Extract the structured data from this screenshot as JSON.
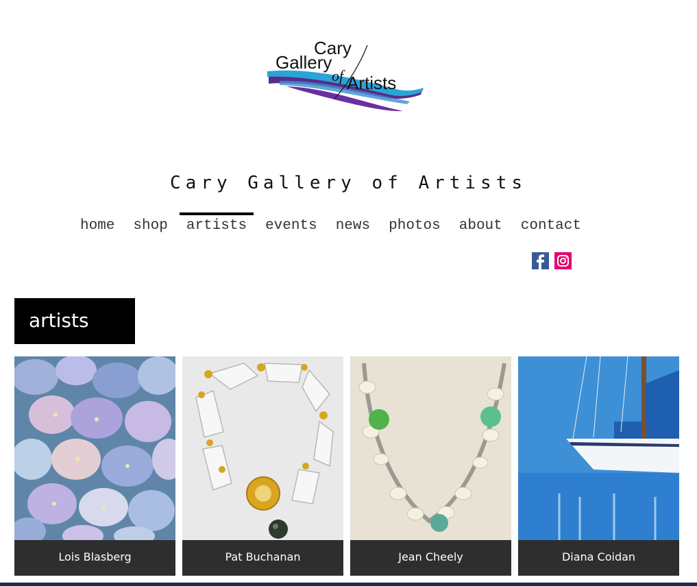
{
  "logo": {
    "line1": "Cary",
    "line2": "Gallery",
    "line3": "of",
    "line4": "Artists"
  },
  "site_title": "Cary Gallery of Artists",
  "nav": {
    "items": [
      {
        "label": "home"
      },
      {
        "label": "shop"
      },
      {
        "label": "artists",
        "active": true
      },
      {
        "label": "events"
      },
      {
        "label": "news"
      },
      {
        "label": "photos"
      },
      {
        "label": "about"
      },
      {
        "label": "contact"
      }
    ]
  },
  "social": {
    "facebook_icon": "facebook-icon",
    "instagram_icon": "instagram-icon",
    "facebook_color": "#3b5998",
    "instagram_color": "#e4006f"
  },
  "section": {
    "title": "artists"
  },
  "artists": [
    {
      "name": "Lois Blasberg"
    },
    {
      "name": "Pat Buchanan"
    },
    {
      "name": "Jean Cheely"
    },
    {
      "name": "Diana Coidan"
    }
  ],
  "colors": {
    "caption_bg": "#2f2e2e",
    "header_bg": "#000000",
    "logo_blue": "#2aa4d8",
    "logo_purple": "#5a2a8c"
  }
}
